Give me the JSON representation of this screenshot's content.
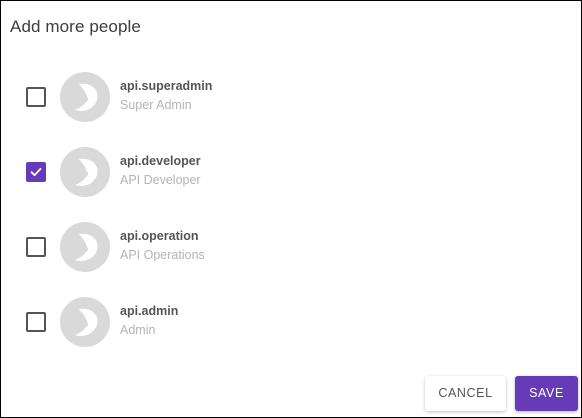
{
  "dialog": {
    "title": "Add more people"
  },
  "people": [
    {
      "name": "api.superadmin",
      "role": "Super Admin",
      "checked": false
    },
    {
      "name": "api.developer",
      "role": "API Developer",
      "checked": true
    },
    {
      "name": "api.operation",
      "role": "API Operations",
      "checked": false
    },
    {
      "name": "api.admin",
      "role": "Admin",
      "checked": false
    }
  ],
  "actions": {
    "cancel_label": "CANCEL",
    "save_label": "SAVE"
  },
  "colors": {
    "accent": "#673ab7",
    "avatar_bg": "#d9d9d9",
    "avatar_logo": "#ffffff"
  },
  "icons": {
    "avatar": "default-user-logo-icon",
    "check": "check-icon"
  }
}
